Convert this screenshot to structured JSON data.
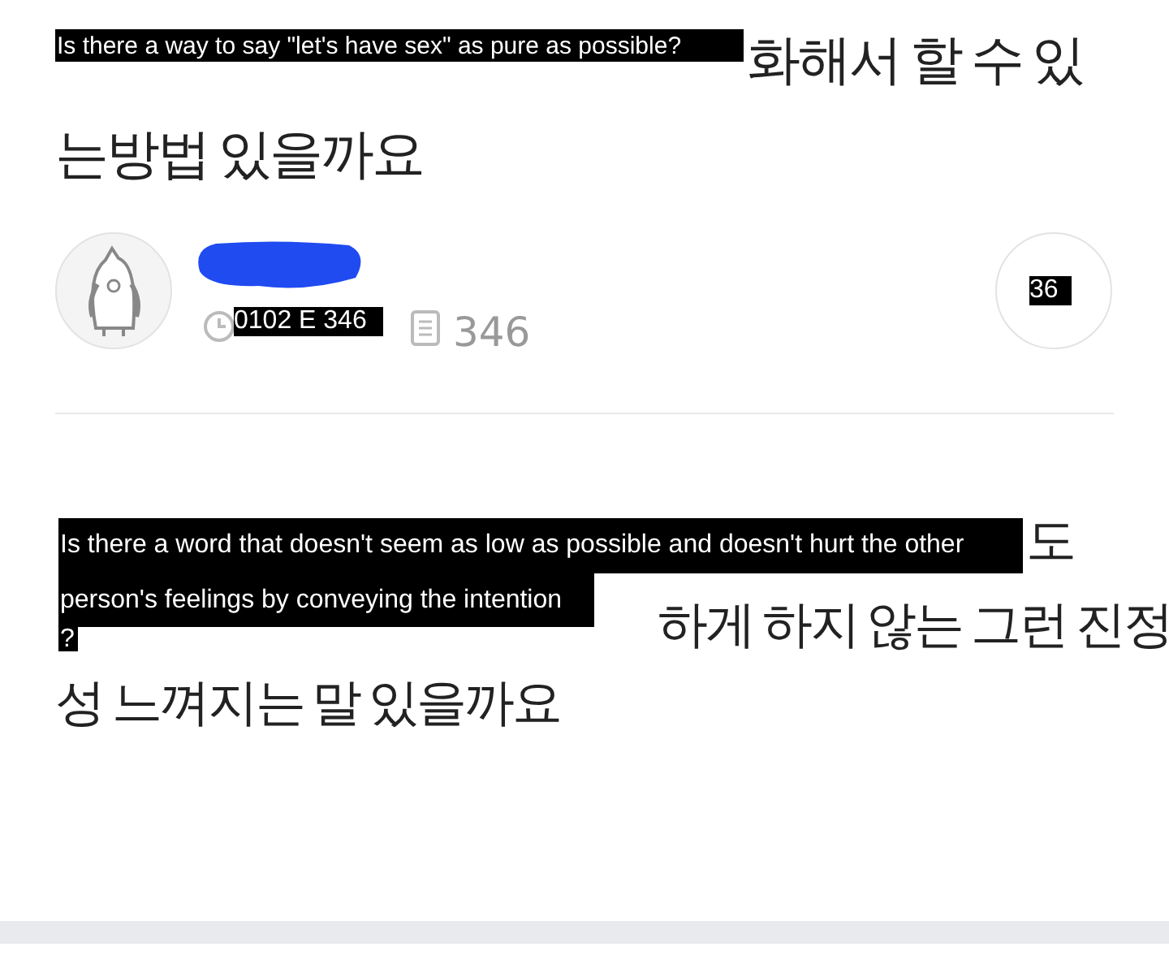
{
  "title": {
    "translation": "Is there a way to say \"let's have sex\" as pure as possible?",
    "lines": [
      "화해서 할 수 있",
      "는방법 있을까요"
    ]
  },
  "author": {
    "date_translation": "0102 E 346",
    "views": "346",
    "badge_translation": "36"
  },
  "body": {
    "translations": [
      "Is there a word that doesn't seem as low as possible and doesn't hurt the other",
      "person's feelings by conveying the intention",
      "?"
    ],
    "lines": [
      "도",
      "하게 하지 않는 그런 진정",
      "성 느껴지는 말 있을까요"
    ]
  }
}
